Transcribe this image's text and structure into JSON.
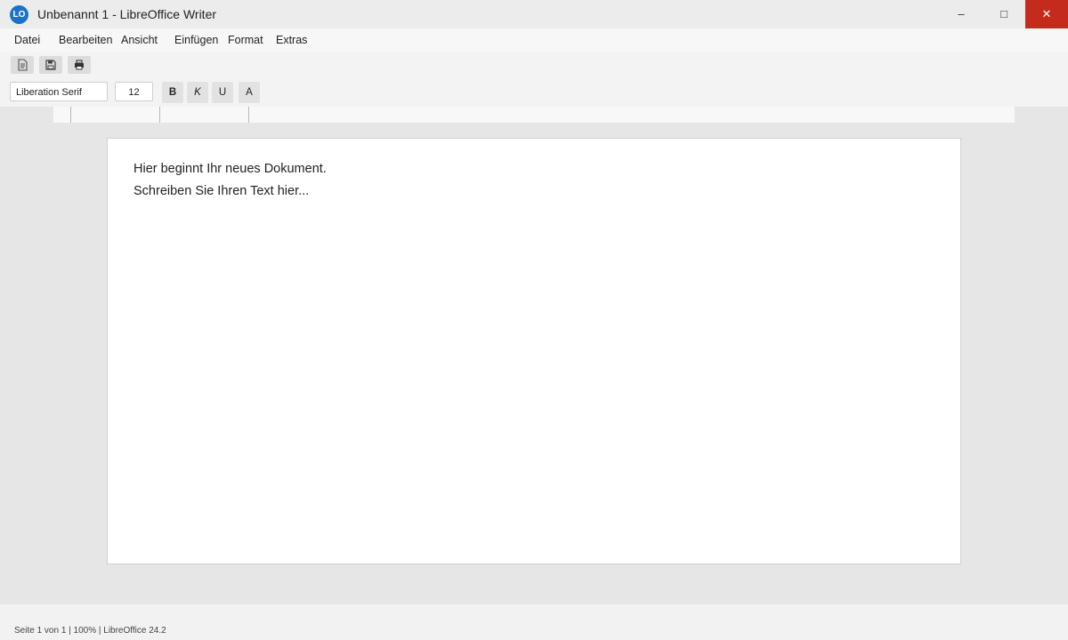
{
  "window": {
    "logo_text": "LO",
    "title": "Unbenannt 1 - LibreOffice Writer",
    "controls": {
      "minimize": "–",
      "maximize": "□",
      "close": "✕"
    }
  },
  "menu": {
    "items": [
      {
        "label": "Datei"
      },
      {
        "label": "Bearbeiten"
      },
      {
        "label": "Ansicht"
      },
      {
        "label": "Einfügen"
      },
      {
        "label": "Format"
      },
      {
        "label": "Extras"
      }
    ]
  },
  "toolbar": {
    "buttons": [
      {
        "icon": "new-document-icon"
      },
      {
        "icon": "save-icon"
      },
      {
        "icon": "print-icon"
      }
    ]
  },
  "formatting": {
    "font_name": "Liberation Serif",
    "font_size": "12",
    "bold": "B",
    "italic": "K",
    "underline": "U",
    "font_color": "A"
  },
  "document": {
    "lines": [
      "Hier beginnt Ihr neues Dokument.",
      "Schreiben Sie Ihren Text hier..."
    ]
  },
  "status": {
    "text": "Seite 1 von 1 | 100% | LibreOffice 24.2"
  },
  "colors": {
    "accent": "#1a73c8",
    "close_button": "#c42b1c",
    "workspace": "#e6e6e6"
  }
}
